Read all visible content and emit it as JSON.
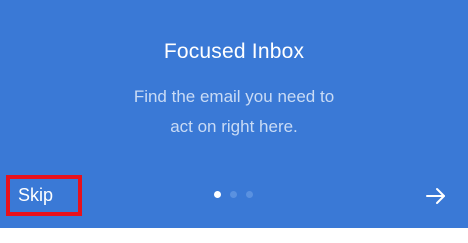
{
  "onboarding": {
    "title": "Focused Inbox",
    "subtitle_line1": "Find the email you need to",
    "subtitle_line2": "act on right here.",
    "skip_label": "Skip",
    "pager": {
      "total": 3,
      "current": 1
    },
    "next_icon": "arrow-right-icon",
    "colors": {
      "background": "#3a79d6",
      "highlight_border": "#e8111c"
    }
  }
}
